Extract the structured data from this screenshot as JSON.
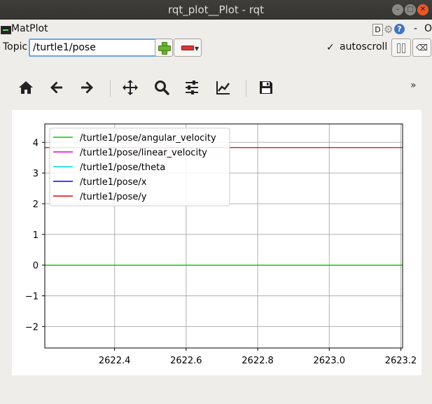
{
  "window": {
    "title": "rqt_plot__Plot - rqt",
    "controls": [
      "minimize-icon",
      "maximize-icon",
      "close-icon"
    ]
  },
  "plugin": {
    "name": "MatPlot",
    "d_label": "D",
    "help_label": "?",
    "close_label": "-",
    "extra_label": "O"
  },
  "topic": {
    "label": "Topic",
    "value": "/turtle1/pose",
    "autoscroll_checked": true,
    "autoscroll_label": "autoscroll"
  },
  "toolbar": {
    "tools": [
      "home-icon",
      "back-icon",
      "forward-icon",
      "pan-icon",
      "zoom-icon",
      "configure-subplots-icon",
      "edit-axis-icon",
      "save-icon"
    ],
    "more_label": "»"
  },
  "chart_data": {
    "type": "line",
    "title": "",
    "xlabel": "",
    "ylabel": "",
    "xlim": [
      2622.205,
      2623.205
    ],
    "ylim": [
      -2.7,
      4.6
    ],
    "xticks": [
      2622.4,
      2622.6,
      2622.8,
      2623.0,
      2623.2
    ],
    "xtick_labels": [
      "2622.4",
      "2622.6",
      "2622.8",
      "2623.0",
      "2623.2"
    ],
    "yticks": [
      -2,
      -1,
      0,
      1,
      2,
      3,
      4
    ],
    "ytick_labels": [
      "−2",
      "−1",
      "0",
      "1",
      "2",
      "3",
      "4"
    ],
    "grid": true,
    "legend_position": "upper-left",
    "series": [
      {
        "name": "/turtle1/pose/angular_velocity",
        "color": "#00d000",
        "x": [
          2622.205,
          2623.205
        ],
        "y": [
          0,
          0
        ]
      },
      {
        "name": "/turtle1/pose/linear_velocity",
        "color": "#e000e0",
        "x": [
          2622.205,
          2623.205
        ],
        "y": [
          0,
          0
        ]
      },
      {
        "name": "/turtle1/pose/theta",
        "color": "#00e0e0",
        "x": [
          2622.205,
          2623.205
        ],
        "y": [
          0,
          0
        ]
      },
      {
        "name": "/turtle1/pose/x",
        "color": "#0000ff",
        "x": [
          2622.205,
          2623.205
        ],
        "y": [
          0,
          0
        ]
      },
      {
        "name": "/turtle1/pose/y",
        "color": "#e00000",
        "x": [
          2622.205,
          2623.205
        ],
        "y": [
          3.83,
          3.83
        ]
      }
    ]
  }
}
